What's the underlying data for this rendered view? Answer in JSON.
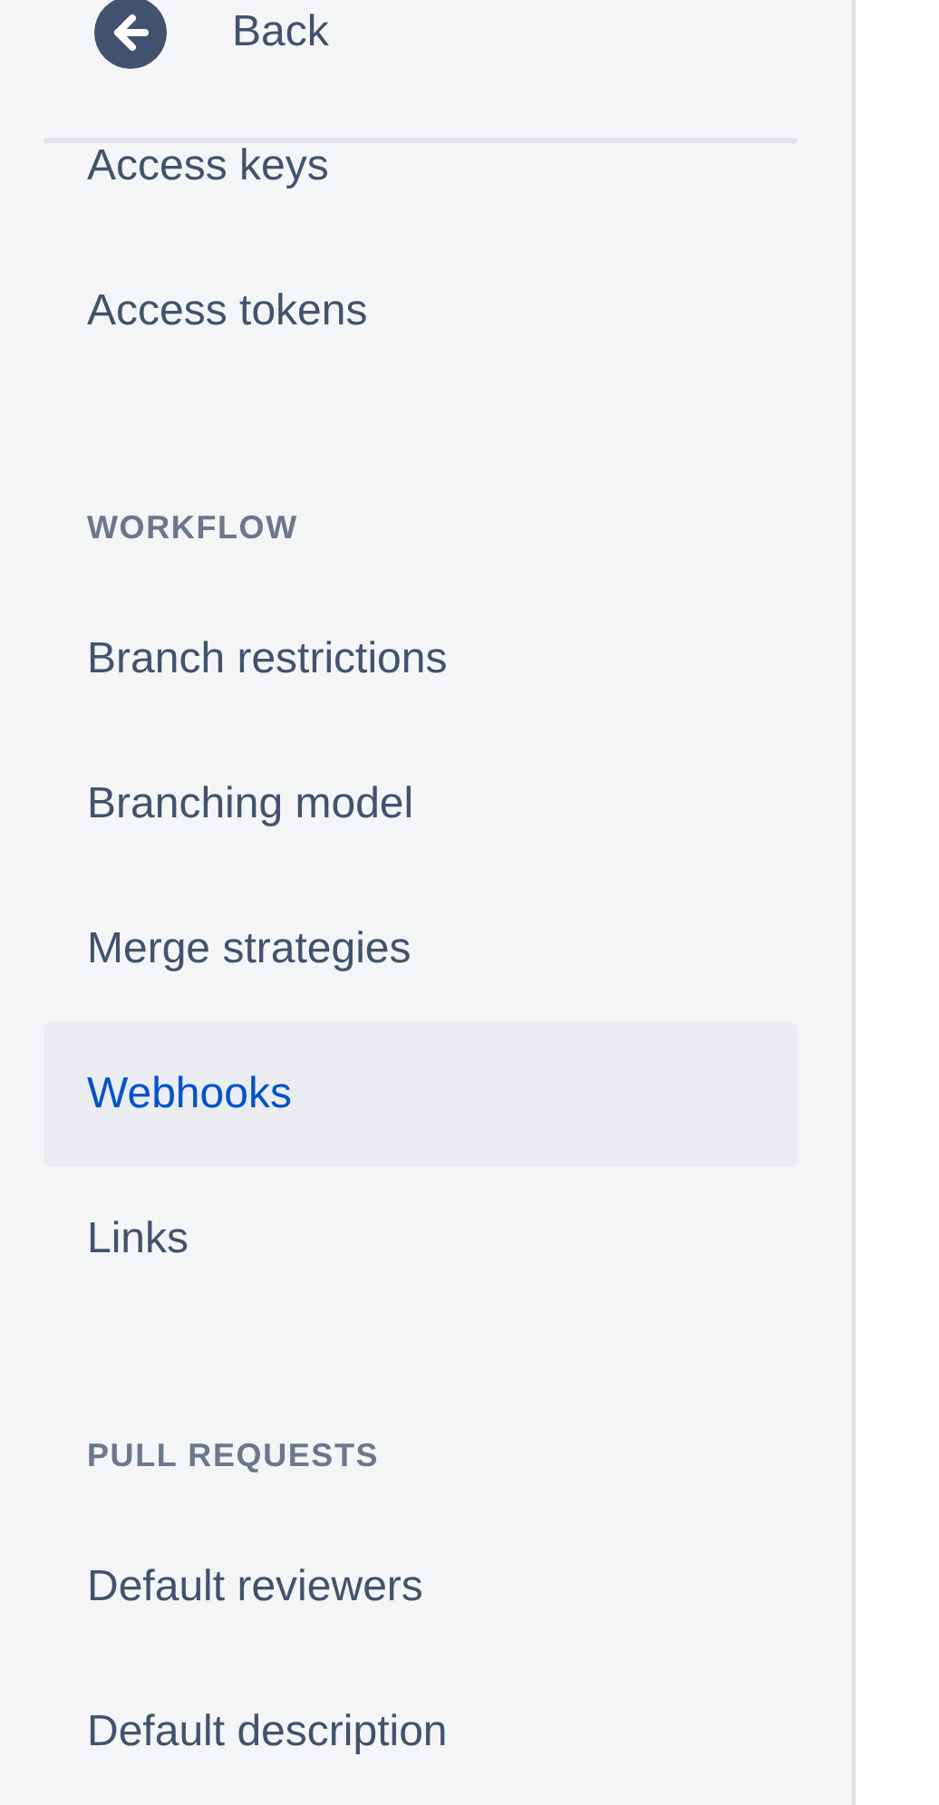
{
  "header": {
    "back": "Back"
  },
  "sections": [
    {
      "items": [
        {
          "label": "Access keys",
          "selected": false
        },
        {
          "label": "Access tokens",
          "selected": false
        }
      ]
    },
    {
      "title": "WORKFLOW",
      "items": [
        {
          "label": "Branch restrictions",
          "selected": false
        },
        {
          "label": "Branching model",
          "selected": false
        },
        {
          "label": "Merge strategies",
          "selected": false
        },
        {
          "label": "Webhooks",
          "selected": true
        },
        {
          "label": "Links",
          "selected": false
        }
      ]
    },
    {
      "title": "PULL REQUESTS",
      "items": [
        {
          "label": "Default reviewers",
          "selected": false
        },
        {
          "label": "Default description",
          "selected": false
        }
      ]
    }
  ]
}
